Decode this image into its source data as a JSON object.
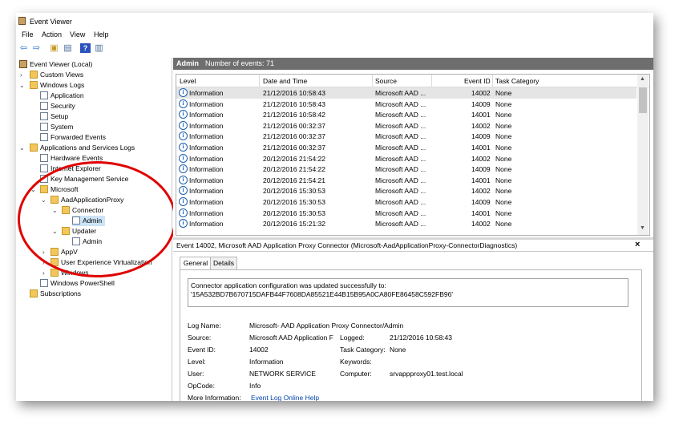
{
  "window": {
    "title": "Event Viewer"
  },
  "menu": [
    "File",
    "Action",
    "View",
    "Help"
  ],
  "toolbar": {
    "icons": [
      "back-arrow-icon",
      "forward-arrow-icon",
      "folder-up-icon",
      "console-tree-icon",
      "help-icon",
      "properties-icon"
    ]
  },
  "tree": [
    {
      "label": "Event Viewer (Local)",
      "icon": "event-viewer-icon"
    },
    {
      "label": "Custom Views",
      "icon": "folder-icon"
    },
    {
      "label": "Windows Logs",
      "icon": "folder-icon"
    },
    {
      "label": "Application",
      "icon": "log-icon"
    },
    {
      "label": "Security",
      "icon": "log-icon"
    },
    {
      "label": "Setup",
      "icon": "log-icon"
    },
    {
      "label": "System",
      "icon": "log-icon"
    },
    {
      "label": "Forwarded Events",
      "icon": "log-icon"
    },
    {
      "label": "Applications and Services Logs",
      "icon": "folder-icon"
    },
    {
      "label": "Hardware Events",
      "icon": "log-icon"
    },
    {
      "label": "Internet Explorer",
      "icon": "log-icon"
    },
    {
      "label": "Key Management Service",
      "icon": "log-icon"
    },
    {
      "label": "Microsoft",
      "icon": "folder-icon"
    },
    {
      "label": "AadApplicationProxy",
      "icon": "folder-icon"
    },
    {
      "label": "Connector",
      "icon": "folder-icon"
    },
    {
      "label": "Admin",
      "icon": "log-icon"
    },
    {
      "label": "Updater",
      "icon": "folder-icon"
    },
    {
      "label": "Admin",
      "icon": "log-icon"
    },
    {
      "label": "AppV",
      "icon": "folder-icon"
    },
    {
      "label": "User Experience Virtualization",
      "icon": "folder-icon"
    },
    {
      "label": "Windows",
      "icon": "folder-icon"
    },
    {
      "label": "Windows PowerShell",
      "icon": "log-icon"
    },
    {
      "label": "Subscriptions",
      "icon": "subscriptions-icon"
    }
  ],
  "events_header": {
    "name": "Admin",
    "count_text": "Number of events: 71"
  },
  "columns": [
    "Level",
    "Date and Time",
    "Source",
    "Event ID",
    "Task Category"
  ],
  "events": [
    {
      "level": "Information",
      "date": "21/12/2016 10:58:43",
      "source": "Microsoft AAD ...",
      "id": "14002",
      "task": "None"
    },
    {
      "level": "Information",
      "date": "21/12/2016 10:58:43",
      "source": "Microsoft AAD ...",
      "id": "14009",
      "task": "None"
    },
    {
      "level": "Information",
      "date": "21/12/2016 10:58:42",
      "source": "Microsoft AAD ...",
      "id": "14001",
      "task": "None"
    },
    {
      "level": "Information",
      "date": "21/12/2016 00:32:37",
      "source": "Microsoft AAD ...",
      "id": "14002",
      "task": "None"
    },
    {
      "level": "Information",
      "date": "21/12/2016 00:32:37",
      "source": "Microsoft AAD ...",
      "id": "14009",
      "task": "None"
    },
    {
      "level": "Information",
      "date": "21/12/2016 00:32:37",
      "source": "Microsoft AAD ...",
      "id": "14001",
      "task": "None"
    },
    {
      "level": "Information",
      "date": "20/12/2016 21:54:22",
      "source": "Microsoft AAD ...",
      "id": "14002",
      "task": "None"
    },
    {
      "level": "Information",
      "date": "20/12/2016 21:54:22",
      "source": "Microsoft AAD ...",
      "id": "14009",
      "task": "None"
    },
    {
      "level": "Information",
      "date": "20/12/2016 21:54:21",
      "source": "Microsoft AAD ...",
      "id": "14001",
      "task": "None"
    },
    {
      "level": "Information",
      "date": "20/12/2016 15:30:53",
      "source": "Microsoft AAD ...",
      "id": "14002",
      "task": "None"
    },
    {
      "level": "Information",
      "date": "20/12/2016 15:30:53",
      "source": "Microsoft AAD ...",
      "id": "14009",
      "task": "None"
    },
    {
      "level": "Information",
      "date": "20/12/2016 15:30:53",
      "source": "Microsoft AAD ...",
      "id": "14001",
      "task": "None"
    },
    {
      "level": "Information",
      "date": "20/12/2016 15:21:32",
      "source": "Microsoft AAD ...",
      "id": "14002",
      "task": "None"
    }
  ],
  "detail": {
    "header": "Event 14002, Microsoft AAD Application Proxy Connector (Microsoft-AadApplicationProxy-ConnectorDiagnostics)",
    "close": "×",
    "tabs": [
      "General",
      "Details"
    ],
    "description_line1": "Connector application configuration was updated successfully to:",
    "description_line2": "'15A532BD7B670715DAFB44F7608DA85521E44B15B95A0CA80FE86458C592FB96'",
    "log_name_label": "Log Name:",
    "log_name": "Microsoft- AAD Application Proxy Connector/Admin",
    "source_label": "Source:",
    "source": "Microsoft AAD Application F",
    "logged_label": "Logged:",
    "logged": "21/12/2016 10:58:43",
    "event_id_label": "Event ID:",
    "event_id": "14002",
    "task_label": "Task Category:",
    "task": "None",
    "level_label": "Level:",
    "level": "Information",
    "keywords_label": "Keywords:",
    "keywords": "",
    "user_label": "User:",
    "user": "NETWORK SERVICE",
    "computer_label": "Computer:",
    "computer": "srvappproxy01.test.local",
    "opcode_label": "OpCode:",
    "opcode": "Info",
    "more_info_label": "More Information:",
    "more_info_link": "Event Log Online Help"
  }
}
